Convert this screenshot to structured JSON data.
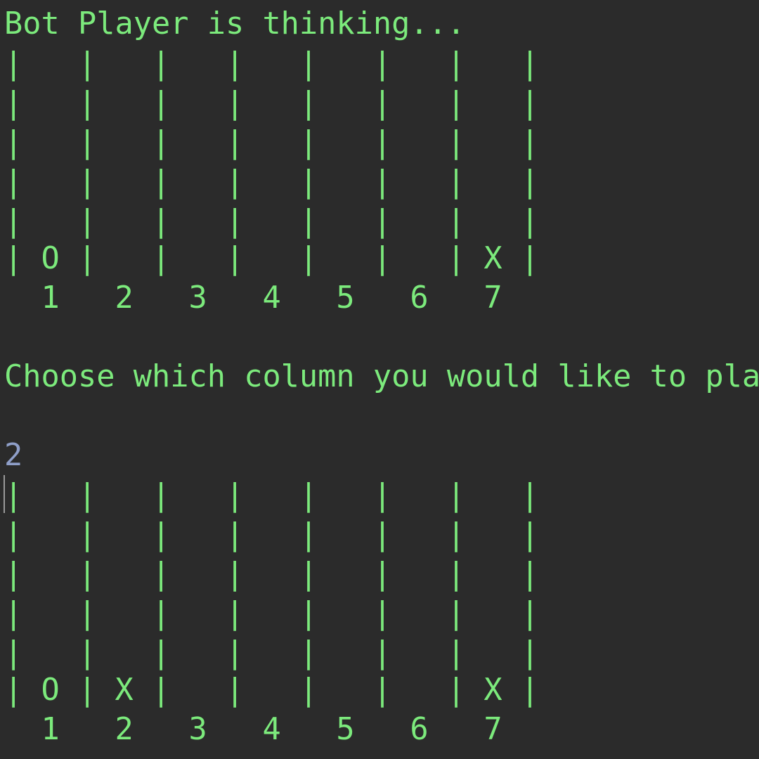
{
  "status": {
    "thinking_text": "Bot Player is thinking..."
  },
  "boards": [
    {
      "rows": [
        "|   |   |   |   |   |   |   |",
        "|   |   |   |   |   |   |   |",
        "|   |   |   |   |   |   |   |",
        "|   |   |   |   |   |   |   |",
        "|   |   |   |   |   |   |   |",
        "| O |   |   |   |   |   | X |"
      ],
      "column_numbers": "  1   2   3   4   5   6   7"
    },
    {
      "rows": [
        "|   |   |   |   |   |   |   |",
        "|   |   |   |   |   |   |   |",
        "|   |   |   |   |   |   |   |",
        "|   |   |   |   |   |   |   |",
        "|   |   |   |   |   |   |   |",
        "| O | X |   |   |   |   | X |"
      ],
      "column_numbers": "  1   2   3   4   5   6   7"
    }
  ],
  "prompt": {
    "text": "Choose which column you would like to pla"
  },
  "input": {
    "value": "2"
  },
  "colors": {
    "background": "#2b2b2b",
    "output_text": "#7cea7c",
    "input_echo": "#8f9fc9"
  }
}
